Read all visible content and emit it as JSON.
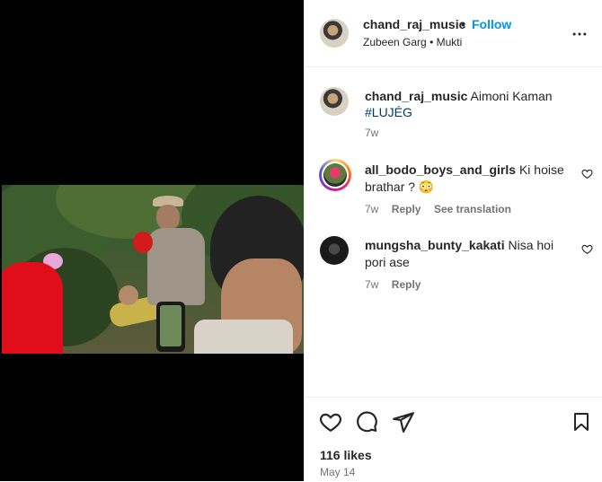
{
  "post": {
    "username": "chand_raj_music",
    "follow_separator": "•",
    "follow_label": "Follow",
    "audio_artist": "Zubeen Garg",
    "audio_separator": "•",
    "audio_title": "Mukti",
    "more_icon": "more-horizontal-icon"
  },
  "caption": {
    "username": "chand_raj_music",
    "text": "Aimoni Kaman",
    "hashtag": "#LUJÉG",
    "time": "7w"
  },
  "comments": [
    {
      "username": "all_bodo_boys_and_girls",
      "text_line1": "Ki hoise",
      "text_line2": "brathar ? 😳",
      "time": "7w",
      "reply_label": "Reply",
      "translation_label": "See translation"
    },
    {
      "username": "mungsha_bunty_kakati",
      "text_line1": "Nisa hoi",
      "text_line2": "pori ase",
      "time": "7w",
      "reply_label": "Reply"
    }
  ],
  "footer": {
    "likes": "116 likes",
    "date": "May 14",
    "icons": [
      "heart-icon",
      "comment-icon",
      "share-icon",
      "bookmark-icon"
    ]
  },
  "colors": {
    "accent": "#0095f6",
    "text": "#262626",
    "muted": "#737373",
    "hashtag": "#00376b"
  }
}
